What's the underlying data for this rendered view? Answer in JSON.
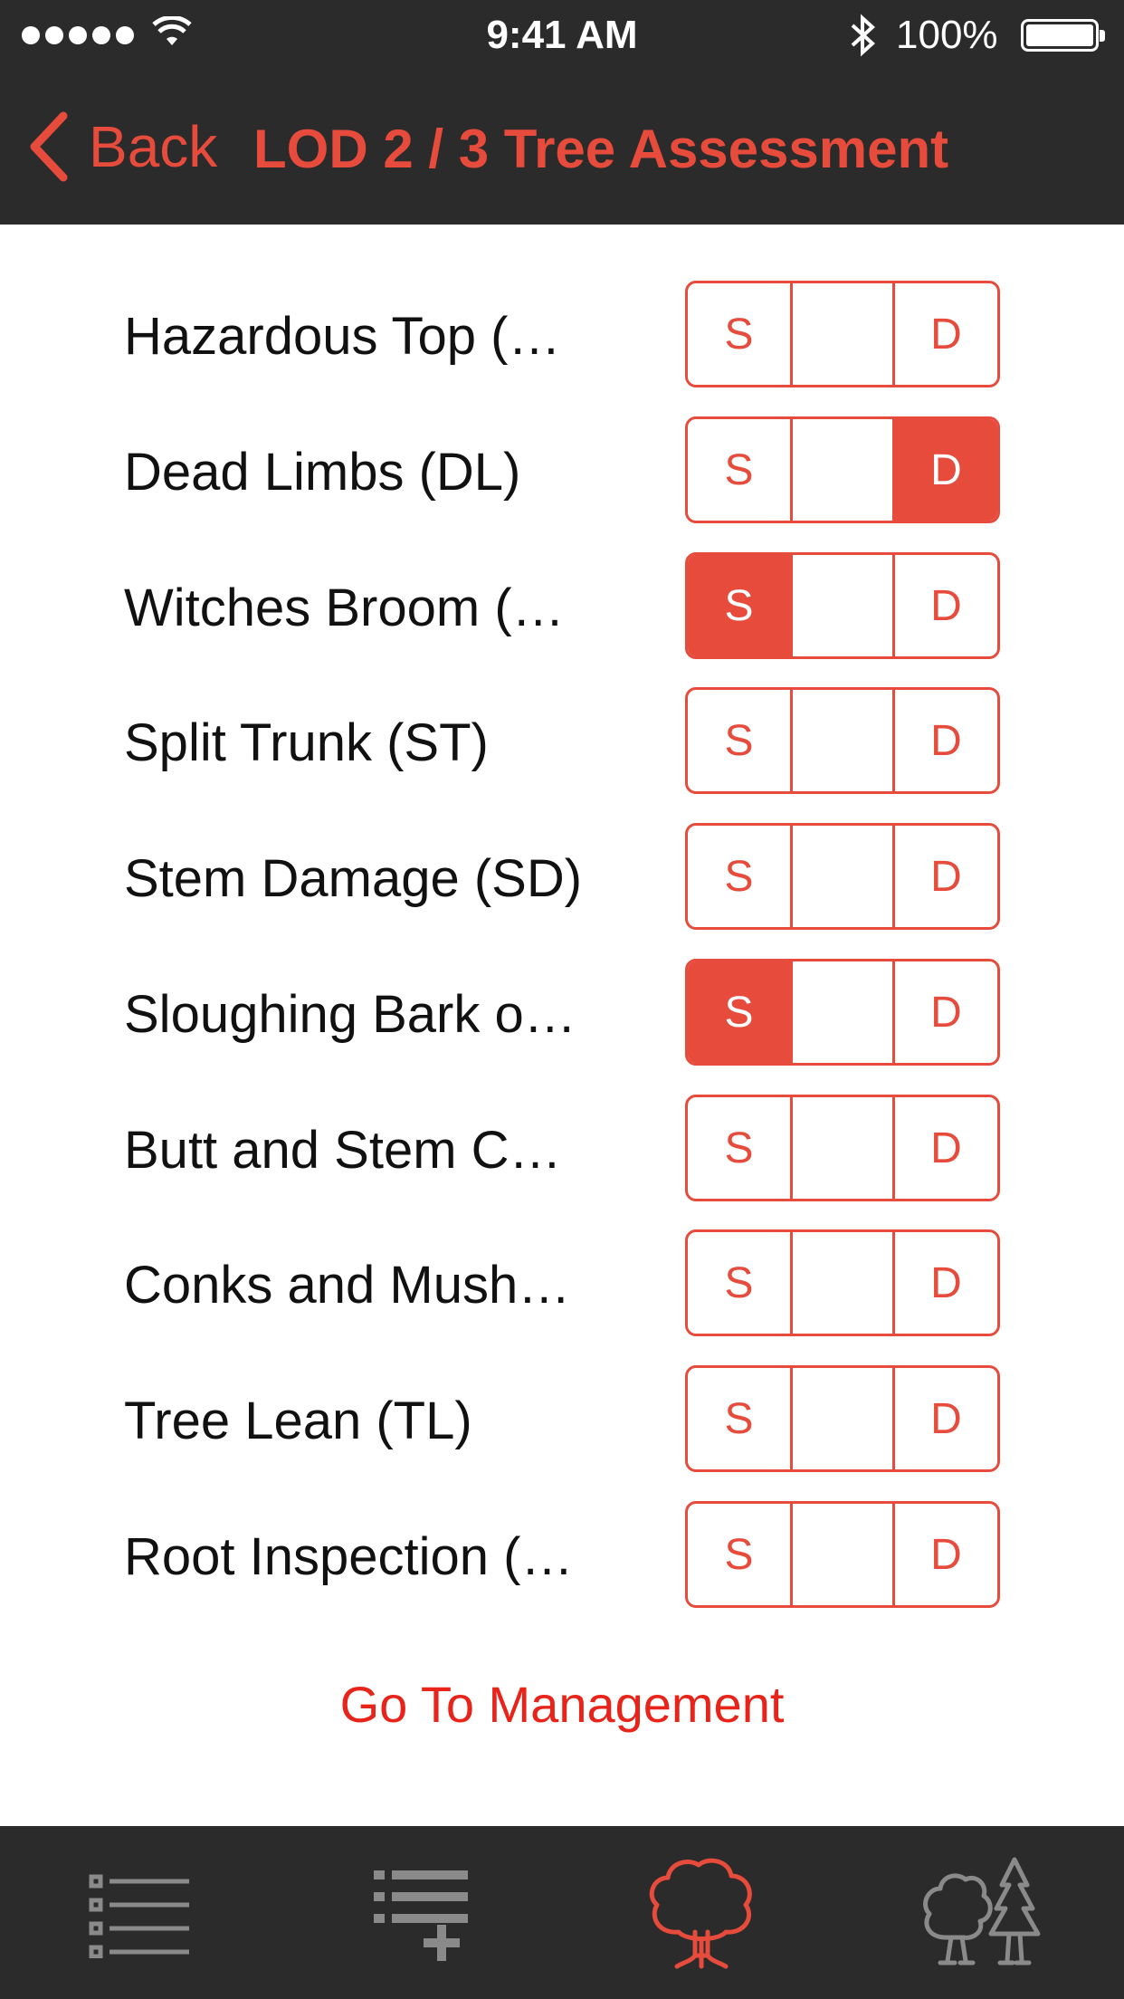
{
  "status_bar": {
    "time": "9:41 AM",
    "battery": "100%"
  },
  "nav": {
    "back_label": "Back",
    "title": "LOD 2 / 3 Tree Assessment"
  },
  "rows": [
    {
      "label": "Hazardous Top (…",
      "s": "S",
      "d": "D",
      "selected": "none"
    },
    {
      "label": "Dead Limbs (DL)",
      "s": "S",
      "d": "D",
      "selected": "D"
    },
    {
      "label": "Witches Broom (…",
      "s": "S",
      "d": "D",
      "selected": "S"
    },
    {
      "label": "Split Trunk (ST)",
      "s": "S",
      "d": "D",
      "selected": "none"
    },
    {
      "label": "Stem Damage (SD)",
      "s": "S",
      "d": "D",
      "selected": "none"
    },
    {
      "label": "Sloughing Bark o…",
      "s": "S",
      "d": "D",
      "selected": "S"
    },
    {
      "label": "Butt and Stem C…",
      "s": "S",
      "d": "D",
      "selected": "none"
    },
    {
      "label": "Conks and Mush…",
      "s": "S",
      "d": "D",
      "selected": "none"
    },
    {
      "label": "Tree Lean (TL)",
      "s": "S",
      "d": "D",
      "selected": "none"
    },
    {
      "label": "Root Inspection (…",
      "s": "S",
      "d": "D",
      "selected": "none"
    }
  ],
  "footer_link": "Go To Management",
  "tabs": [
    {
      "icon": "list-icon",
      "active": false
    },
    {
      "icon": "add-list-icon",
      "active": false
    },
    {
      "icon": "tree-icon",
      "active": true
    },
    {
      "icon": "forest-icon",
      "active": false
    }
  ],
  "colors": {
    "accent": "#e64b3c",
    "bar": "#2b2b2b",
    "link": "#e8241a",
    "inactive_icon": "#8a8a8a"
  }
}
